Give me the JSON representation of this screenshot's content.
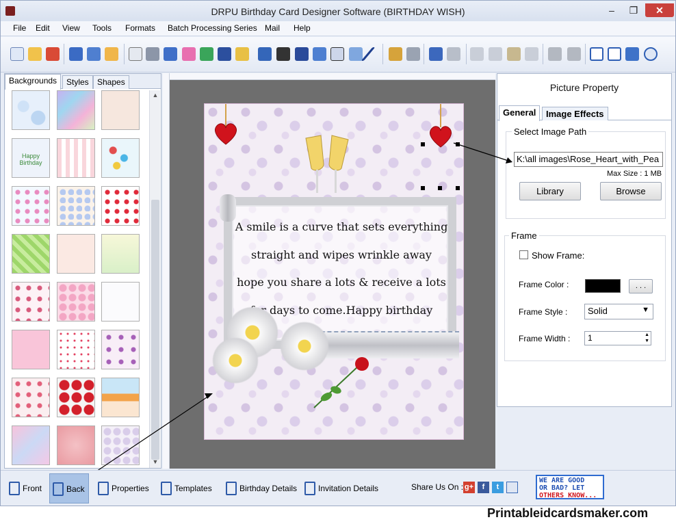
{
  "window": {
    "title": "DRPU Birthday Card Designer Software (BIRTHDAY WISH)"
  },
  "menu": [
    "File",
    "Edit",
    "View",
    "Tools",
    "Formats",
    "Batch Processing Series",
    "Mail",
    "Help"
  ],
  "left_panel": {
    "tabs": [
      "Backgrounds",
      "Styles",
      "Shapes"
    ],
    "active_tab": "Backgrounds",
    "thumbnail_text": "Happy Birthday"
  },
  "card": {
    "message_lines": [
      "A smile is a curve that sets everything",
      "straight and wipes wrinkle away",
      "hope you share a lots & receive a lots",
      "for days to come.Happy birthday"
    ]
  },
  "picture_property": {
    "title": "Picture Property",
    "tabs": [
      "General",
      "Image Effects"
    ],
    "active_tab": "General",
    "image_path_label": "Select Image Path",
    "image_path_value": "K:\\all images\\Rose_Heart_with_Pea",
    "max_size": "Max Size : 1 MB",
    "library_button": "Library",
    "browse_button": "Browse",
    "frame": {
      "title": "Frame",
      "show_frame_label": "Show Frame:",
      "show_frame_checked": false,
      "color_label": "Frame Color :",
      "color_value": "#000000",
      "color_button": ". . .",
      "style_label": "Frame Style :",
      "style_value": "Solid",
      "width_label": "Frame Width :",
      "width_value": "1"
    }
  },
  "bottom_bar": {
    "items": [
      "Front",
      "Back",
      "Properties",
      "Templates",
      "Birthday Details",
      "Invitation Details"
    ],
    "active": "Back",
    "share_label": "Share Us On :",
    "badge_lines": [
      "WE ARE GOOD",
      "OR BAD? LET",
      "OTHERS KNOW..."
    ]
  },
  "watermark": "Printableidcardsmaker.com",
  "colors": {
    "accent": "#a9c3e6",
    "close": "#c9403c",
    "card_bg": "#f3edf5"
  }
}
